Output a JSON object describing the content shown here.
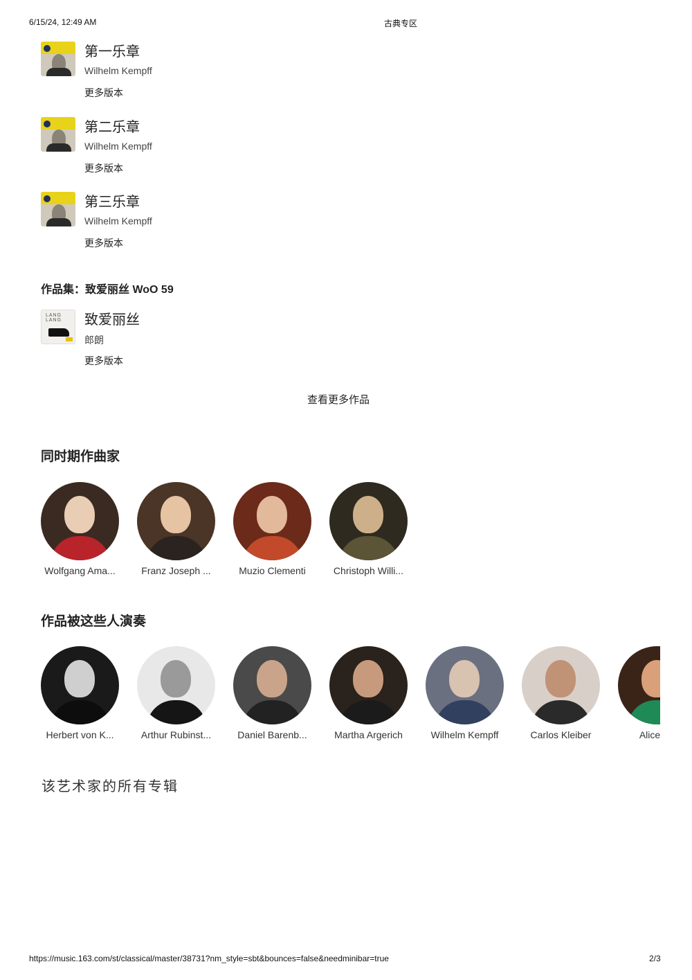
{
  "header": {
    "datetime": "6/15/24, 12:49 AM",
    "page_title": "古典专区"
  },
  "tracks": [
    {
      "title": "第一乐章",
      "artist": "Wilhelm Kempff",
      "more": "更多版本",
      "cover": "deutsche-grammophon-kempff-cover"
    },
    {
      "title": "第二乐章",
      "artist": "Wilhelm Kempff",
      "more": "更多版本",
      "cover": "deutsche-grammophon-kempff-cover"
    },
    {
      "title": "第三乐章",
      "artist": "Wilhelm Kempff",
      "more": "更多版本",
      "cover": "deutsche-grammophon-kempff-cover"
    }
  ],
  "collection": {
    "label": "作品集：致爱丽丝 WoO 59",
    "track": {
      "title": "致爱丽丝",
      "artist": "郎朗",
      "more": "更多版本",
      "cover": "lang-lang-piano-cover"
    }
  },
  "more_works_label": "查看更多作品",
  "contemporaries": {
    "title": "同时期作曲家",
    "people": [
      {
        "name": "Wolfgang Ama...",
        "colors": {
          "bg": "#3a2a22",
          "head": "#e9cdb4",
          "torso": "#b8242a"
        }
      },
      {
        "name": "Franz Joseph ...",
        "colors": {
          "bg": "#4a3526",
          "head": "#e6c3a2",
          "torso": "#2b2320"
        }
      },
      {
        "name": "Muzio Clementi",
        "colors": {
          "bg": "#6b2a1a",
          "head": "#e2b99a",
          "torso": "#c24a2a"
        }
      },
      {
        "name": "Christoph Willi...",
        "colors": {
          "bg": "#2e2a20",
          "head": "#cdb08a",
          "torso": "#5b5436"
        }
      }
    ]
  },
  "performers": {
    "title": "作品被这些人演奏",
    "people": [
      {
        "name": "Herbert von K...",
        "colors": {
          "bg": "#1a1a1a",
          "head": "#cfcfcf",
          "torso": "#0d0d0d"
        }
      },
      {
        "name": "Arthur Rubinst...",
        "colors": {
          "bg": "#e8e8e8",
          "head": "#9a9a9a",
          "torso": "#151515"
        }
      },
      {
        "name": "Daniel Barenb...",
        "colors": {
          "bg": "#4a4a4a",
          "head": "#c9a48a",
          "torso": "#222222"
        }
      },
      {
        "name": "Martha Argerich",
        "colors": {
          "bg": "#2a221c",
          "head": "#c79a7e",
          "torso": "#1b1b1b"
        }
      },
      {
        "name": "Wilhelm Kempff",
        "colors": {
          "bg": "#6a7080",
          "head": "#d8c2b0",
          "torso": "#31405e"
        }
      },
      {
        "name": "Carlos Kleiber",
        "colors": {
          "bg": "#d8cfc8",
          "head": "#c09276",
          "torso": "#2a2a2a"
        }
      },
      {
        "name": "Alice Sa",
        "colors": {
          "bg": "#3a2418",
          "head": "#d9a07a",
          "torso": "#1f8a55"
        }
      }
    ]
  },
  "albums_title": "该艺术家的所有专辑",
  "footer": {
    "url": "https://music.163.com/st/classical/master/38731?nm_style=sbt&bounces=false&needminibar=true",
    "page": "2/3"
  }
}
